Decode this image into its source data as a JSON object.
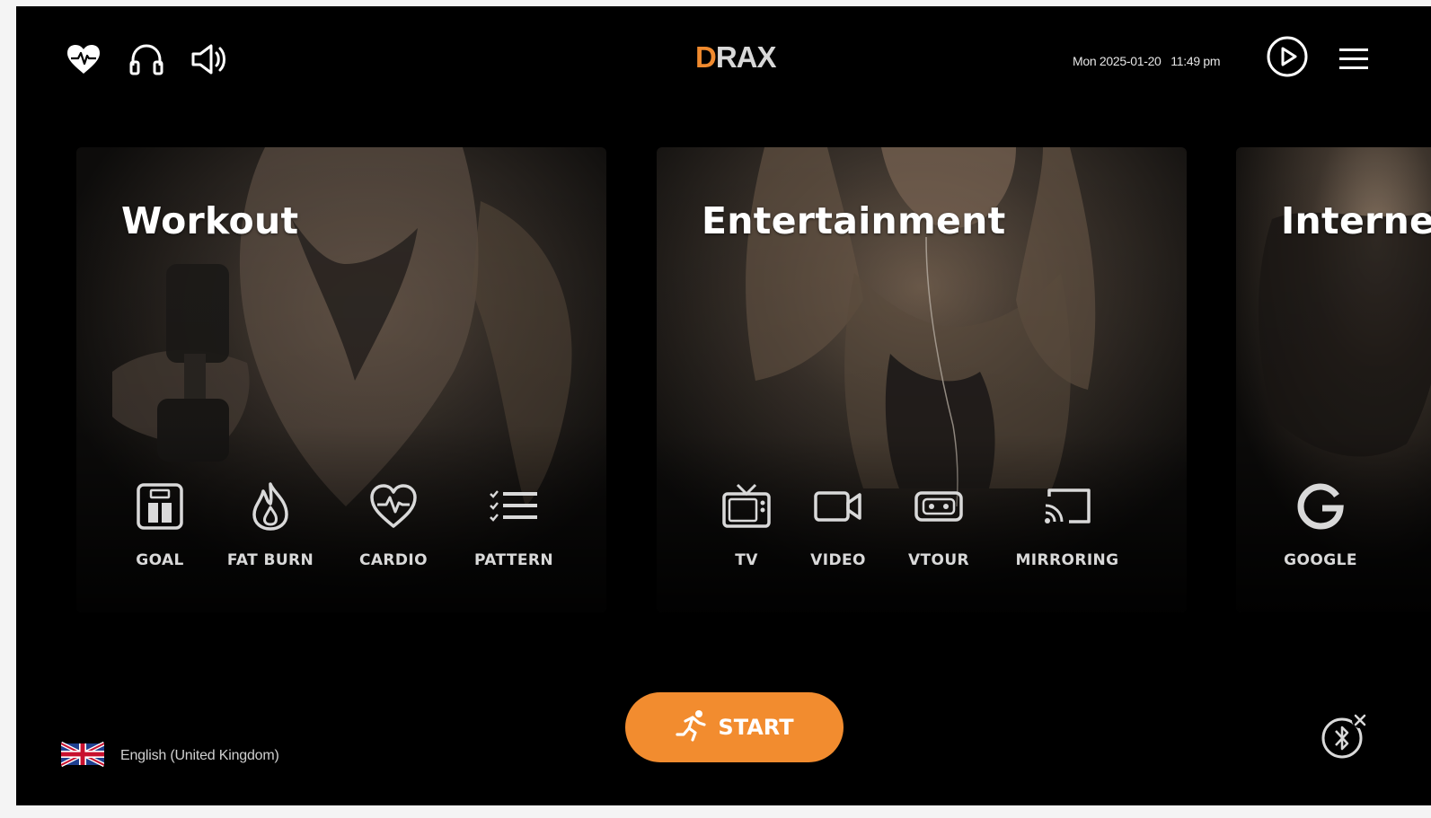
{
  "header": {
    "logo_text_accent": "D",
    "logo_text_rest": "RAX",
    "datetime": "Mon 2025-01-20   11:49 pm",
    "left_icons": [
      "heart-rate-icon",
      "headphones-icon",
      "speaker-icon"
    ],
    "right_icons": [
      "play-circle-icon",
      "hamburger-menu-icon"
    ]
  },
  "cards": [
    {
      "title": "Workout",
      "items": [
        {
          "label": "GOAL",
          "icon": "scale-icon"
        },
        {
          "label": "FAT BURN",
          "icon": "flame-icon"
        },
        {
          "label": "CARDIO",
          "icon": "heart-pulse-icon"
        },
        {
          "label": "PATTERN",
          "icon": "checklist-icon"
        }
      ]
    },
    {
      "title": "Entertainment",
      "items": [
        {
          "label": "TV",
          "icon": "tv-icon"
        },
        {
          "label": "VIDEO",
          "icon": "video-camera-icon"
        },
        {
          "label": "VTOUR",
          "icon": "vr-headset-icon"
        },
        {
          "label": "MIRRORING",
          "icon": "cast-icon"
        }
      ]
    },
    {
      "title": "Interne",
      "items": [
        {
          "label": "GOOGLE",
          "icon": "google-icon"
        }
      ]
    }
  ],
  "start_button": {
    "label": "START",
    "icon": "runner-icon"
  },
  "language": {
    "label": "English (United Kingdom)",
    "icon": "uk-flag-icon"
  },
  "bluetooth": {
    "icon": "bluetooth-off-icon"
  },
  "colors": {
    "accent": "#f28c2f",
    "background": "#000000"
  }
}
